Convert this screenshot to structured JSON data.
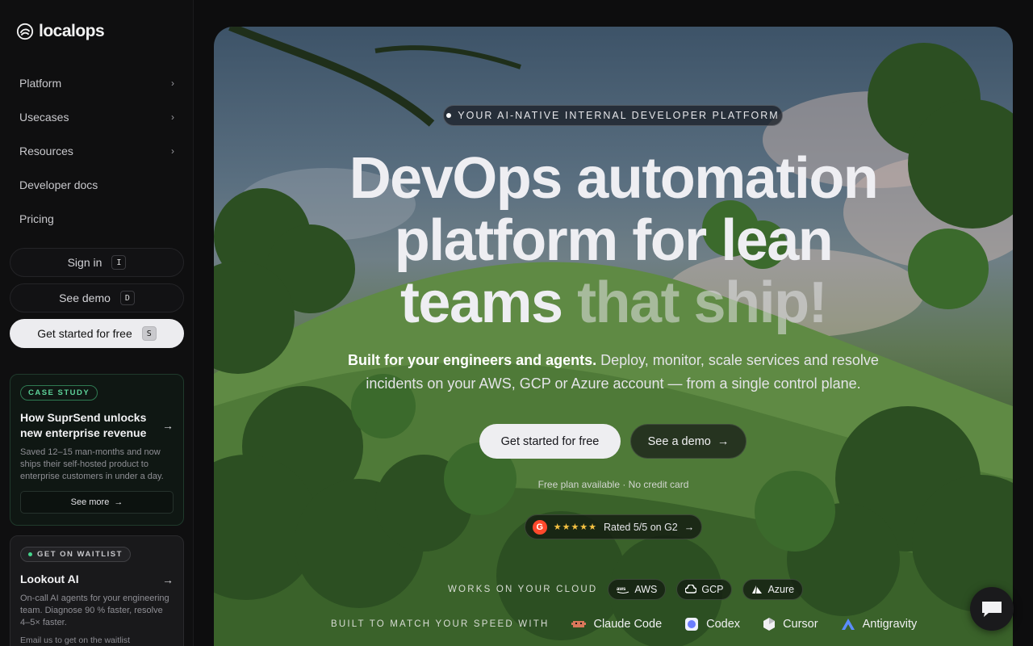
{
  "brand": {
    "name": "localops"
  },
  "nav": {
    "items": [
      {
        "label": "Platform",
        "has_submenu": true
      },
      {
        "label": "Usecases",
        "has_submenu": true
      },
      {
        "label": "Resources",
        "has_submenu": true
      },
      {
        "label": "Developer docs",
        "has_submenu": false
      },
      {
        "label": "Pricing",
        "has_submenu": false
      }
    ],
    "chevron": "›"
  },
  "sidebar_buttons": {
    "sign_in": {
      "label": "Sign in",
      "key": "I"
    },
    "see_demo": {
      "label": "See demo",
      "key": "D"
    },
    "get_started": {
      "label": "Get started for free",
      "key": "S"
    }
  },
  "case_study": {
    "tag": "CASE STUDY",
    "title": "How SuprSend unlocks new enterprise revenue",
    "description": "Saved 12–15 man-months and now ships their self-hosted product to enterprise customers in under a day.",
    "button": "See more",
    "arrow": "→"
  },
  "waitlist": {
    "tag": "GET ON WAITLIST",
    "title": "Lookout AI",
    "description": "On-call AI agents for your engineering team. Diagnose 90 % faster, resolve 4–5× faster.",
    "footer": "Email us to get on the waitlist",
    "arrow": "→"
  },
  "hero": {
    "eyebrow": "YOUR AI-NATIVE INTERNAL DEVELOPER PLATFORM",
    "headline_line1": "DevOps automation",
    "headline_line2": "platform for lean",
    "headline_line3_a": "teams ",
    "headline_line3_b": "that ship!",
    "sub_strong": "Built for your engineers and agents.",
    "sub_rest": " Deploy, monitor, scale services and resolve incidents on your AWS, GCP or Azure account — from a single control plane.",
    "cta_primary": "Get started for free",
    "cta_secondary": "See a demo",
    "cta_arrow": "→",
    "free_note": "Free plan available · No credit card",
    "g2": {
      "logo": "G",
      "stars": "★★★★★",
      "label": "Rated 5/5 on G2",
      "arrow": "→"
    },
    "cloud_label": "WORKS ON YOUR CLOUD",
    "clouds": [
      "AWS",
      "GCP",
      "Azure"
    ],
    "speed_label": "BUILT TO MATCH YOUR SPEED WITH",
    "tools": [
      "Claude Code",
      "Codex",
      "Cursor",
      "Antigravity"
    ]
  },
  "colors": {
    "accent_green": "#45d48c",
    "primary_button": "#eeeef1",
    "sidebar_bg": "#0f0f10"
  },
  "icons": [
    "localops-logo-icon",
    "chevron-right-icon",
    "arrow-right-icon",
    "g2-logo-icon",
    "aws-icon",
    "gcp-cloud-icon",
    "azure-icon",
    "claude-code-icon",
    "codex-icon",
    "cursor-icon",
    "antigravity-icon",
    "chat-icon"
  ]
}
